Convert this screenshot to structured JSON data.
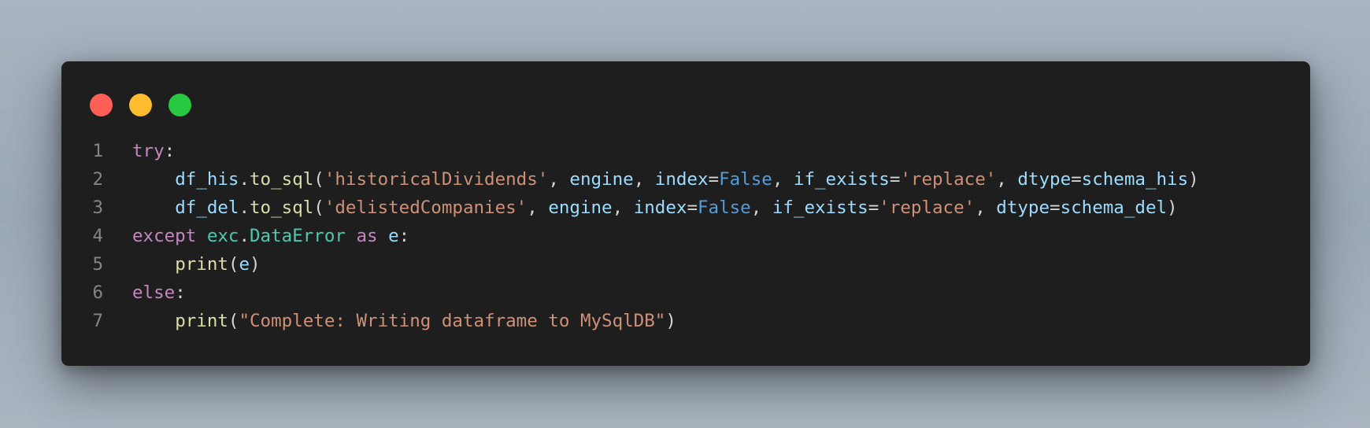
{
  "window_controls": {
    "close_color": "#ff5f57",
    "minimize_color": "#febc2e",
    "maximize_color": "#28c840"
  },
  "code": {
    "language": "python",
    "lines": [
      {
        "number": "1",
        "tokens": [
          {
            "t": "try",
            "c": "kw"
          },
          {
            "t": ":",
            "c": "pl"
          }
        ]
      },
      {
        "number": "2",
        "tokens": [
          {
            "t": "    ",
            "c": "pl"
          },
          {
            "t": "df_his",
            "c": "var"
          },
          {
            "t": ".",
            "c": "pl"
          },
          {
            "t": "to_sql",
            "c": "fn"
          },
          {
            "t": "(",
            "c": "pl"
          },
          {
            "t": "'historicalDividends'",
            "c": "str"
          },
          {
            "t": ", ",
            "c": "pl"
          },
          {
            "t": "engine",
            "c": "var"
          },
          {
            "t": ", ",
            "c": "pl"
          },
          {
            "t": "index",
            "c": "var"
          },
          {
            "t": "=",
            "c": "pl"
          },
          {
            "t": "False",
            "c": "const"
          },
          {
            "t": ", ",
            "c": "pl"
          },
          {
            "t": "if_exists",
            "c": "var"
          },
          {
            "t": "=",
            "c": "pl"
          },
          {
            "t": "'replace'",
            "c": "str"
          },
          {
            "t": ", ",
            "c": "pl"
          },
          {
            "t": "dtype",
            "c": "var"
          },
          {
            "t": "=",
            "c": "pl"
          },
          {
            "t": "schema_his",
            "c": "var"
          },
          {
            "t": ")",
            "c": "pl"
          }
        ]
      },
      {
        "number": "3",
        "tokens": [
          {
            "t": "    ",
            "c": "pl"
          },
          {
            "t": "df_del",
            "c": "var"
          },
          {
            "t": ".",
            "c": "pl"
          },
          {
            "t": "to_sql",
            "c": "fn"
          },
          {
            "t": "(",
            "c": "pl"
          },
          {
            "t": "'delistedCompanies'",
            "c": "str"
          },
          {
            "t": ", ",
            "c": "pl"
          },
          {
            "t": "engine",
            "c": "var"
          },
          {
            "t": ", ",
            "c": "pl"
          },
          {
            "t": "index",
            "c": "var"
          },
          {
            "t": "=",
            "c": "pl"
          },
          {
            "t": "False",
            "c": "const"
          },
          {
            "t": ", ",
            "c": "pl"
          },
          {
            "t": "if_exists",
            "c": "var"
          },
          {
            "t": "=",
            "c": "pl"
          },
          {
            "t": "'replace'",
            "c": "str"
          },
          {
            "t": ", ",
            "c": "pl"
          },
          {
            "t": "dtype",
            "c": "var"
          },
          {
            "t": "=",
            "c": "pl"
          },
          {
            "t": "schema_del",
            "c": "var"
          },
          {
            "t": ")",
            "c": "pl"
          }
        ]
      },
      {
        "number": "4",
        "tokens": [
          {
            "t": "except",
            "c": "kw"
          },
          {
            "t": " ",
            "c": "pl"
          },
          {
            "t": "exc",
            "c": "cls"
          },
          {
            "t": ".",
            "c": "pl"
          },
          {
            "t": "DataError",
            "c": "cls"
          },
          {
            "t": " ",
            "c": "pl"
          },
          {
            "t": "as",
            "c": "kw"
          },
          {
            "t": " ",
            "c": "pl"
          },
          {
            "t": "e",
            "c": "var"
          },
          {
            "t": ":",
            "c": "pl"
          }
        ]
      },
      {
        "number": "5",
        "tokens": [
          {
            "t": "    ",
            "c": "pl"
          },
          {
            "t": "print",
            "c": "fn"
          },
          {
            "t": "(",
            "c": "pl"
          },
          {
            "t": "e",
            "c": "var"
          },
          {
            "t": ")",
            "c": "pl"
          }
        ]
      },
      {
        "number": "6",
        "tokens": [
          {
            "t": "else",
            "c": "kw"
          },
          {
            "t": ":",
            "c": "pl"
          }
        ]
      },
      {
        "number": "7",
        "tokens": [
          {
            "t": "    ",
            "c": "pl"
          },
          {
            "t": "print",
            "c": "fn"
          },
          {
            "t": "(",
            "c": "pl"
          },
          {
            "t": "\"Complete: Writing dataframe to MySqlDB\"",
            "c": "str"
          },
          {
            "t": ")",
            "c": "pl"
          }
        ]
      }
    ]
  },
  "syntax_colors": {
    "keyword": "#c586c0",
    "variable": "#9cdcfe",
    "function": "#dcdcaa",
    "string": "#ce9178",
    "constant": "#569cd6",
    "class": "#4ec9b0",
    "plain": "#d4d4d4",
    "line_number": "#858585",
    "background": "#1e1e1e"
  }
}
